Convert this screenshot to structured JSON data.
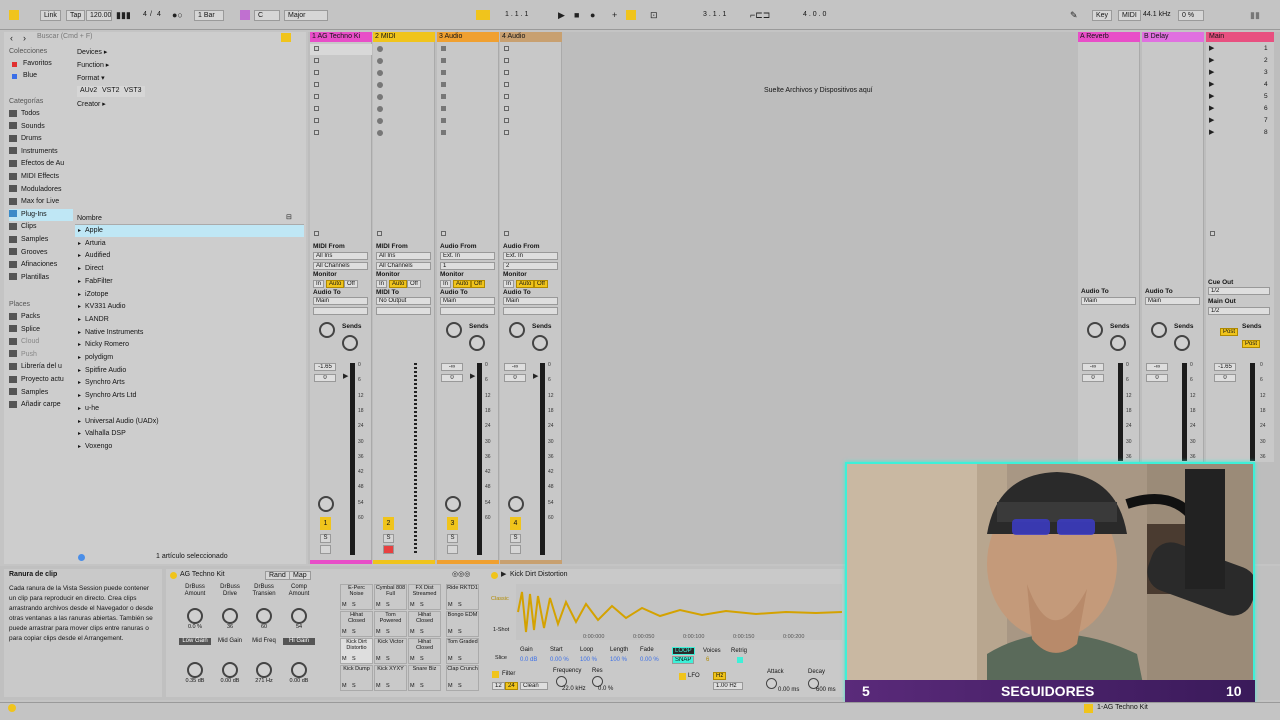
{
  "transport": {
    "link": "Link",
    "tap": "Tap",
    "bpm": "120.00",
    "time_sig_num": "4",
    "time_sig_den": "4",
    "quantize": "1 Bar",
    "key": "C",
    "scale": "Major",
    "position": "1 . 1 . 1",
    "loop_start": "3 . 1 . 1",
    "loop_length": "4 . 0 . 0",
    "key_btn": "Key",
    "midi_btn": "MIDI",
    "sample_rate": "44.1 kHz",
    "cpu": "0 %"
  },
  "browser": {
    "search_placeholder": "Buscar (Cmd + F)",
    "colecciones_header": "Colecciones",
    "colecciones": [
      "Favoritos",
      "Blue"
    ],
    "categorias_header": "Categorías",
    "categorias": [
      "Todos",
      "Sounds",
      "Drums",
      "Instruments",
      "Efectos de Au",
      "MIDI Effects",
      "Moduladores",
      "Max for Live",
      "Plug-Ins",
      "Clips",
      "Samples",
      "Grooves",
      "Afinaciones",
      "Plantillas"
    ],
    "places_header": "Places",
    "places": [
      "Packs",
      "Splice",
      "Cloud",
      "Push",
      "Librería del u",
      "Proyecto actu",
      "Samples",
      "Añadir carpe"
    ],
    "filters": {
      "devices": "Devices ▸",
      "function": "Function ▸",
      "format": "Format ▾",
      "formats": [
        "AUv2",
        "VST2",
        "VST3"
      ],
      "creator": "Creator ▸"
    },
    "nombre_header": "Nombre",
    "items": [
      "Apple",
      "Arturia",
      "Audified",
      "Direct",
      "FabFilter",
      "iZotope",
      "KV331 Audio",
      "LANDR",
      "Native Instruments",
      "Nicky Romero",
      "polydigm",
      "Spitfire Audio",
      "Synchro Arts",
      "Synchro Arts Ltd",
      "u-he",
      "Universal Audio (UADx)",
      "Valhalla DSP",
      "Voxengo"
    ],
    "status": "1 artículo seleccionado"
  },
  "session": {
    "drop_hint": "Suelte Archivos y Dispositivos aquí",
    "tracks": [
      {
        "name": "1 AG Techno Ki",
        "color": "#e84ec8",
        "num": "1",
        "from_label": "MIDI From",
        "from": "All Ins",
        "channel": "All Channels",
        "to": "Main",
        "vol": "-1.65",
        "pan": "0"
      },
      {
        "name": "2 MIDI",
        "color": "#f0c41c",
        "num": "2",
        "from_label": "MIDI From",
        "from": "All Ins",
        "channel": "All Channels",
        "to": "No Output",
        "vol": "",
        "pan": ""
      },
      {
        "name": "3 Audio",
        "color": "#f0a030",
        "num": "3",
        "from_label": "Audio From",
        "from": "Ext. In",
        "channel": "1",
        "to": "Main",
        "vol": "-∞",
        "pan": "0"
      },
      {
        "name": "4 Audio",
        "color": "#c8a070",
        "num": "4",
        "from_label": "Audio From",
        "from": "Ext. In",
        "channel": "2",
        "to": "Main",
        "vol": "-∞",
        "pan": "0"
      }
    ],
    "returns": [
      {
        "name": "A Reverb",
        "color": "#e84ec8",
        "to": "Main",
        "vol": "-∞",
        "pan": "0"
      },
      {
        "name": "B Delay",
        "color": "#e070e0",
        "to": "Main",
        "vol": "-∞",
        "pan": "0"
      }
    ],
    "main": {
      "name": "Main",
      "color": "#e85080",
      "cue_out_label": "Cue Out",
      "cue_out": "1/2",
      "main_out_label": "Main Out",
      "main_out": "1/2",
      "vol": "-1.65",
      "pan": "0",
      "post": "Post",
      "scenes": [
        "1",
        "2",
        "3",
        "4",
        "5",
        "6",
        "7",
        "8"
      ]
    },
    "labels": {
      "monitor": "Monitor",
      "in": "In",
      "auto": "Auto",
      "off": "Off",
      "audio_to": "Audio To",
      "midi_to": "MIDI To",
      "sends": "Sends",
      "audio_from": "Audio From"
    },
    "meter_ticks": [
      "0",
      "6",
      "12",
      "18",
      "24",
      "30",
      "36",
      "42",
      "48",
      "54",
      "60"
    ]
  },
  "info": {
    "title": "Ranura de clip",
    "text": "Cada ranura de la Vista Session puede contener un clip para reproducir en directo. Crea clips arrastrando archivos desde el Navegador o desde otras ventanas a las ranuras abiertas. También se puede arrastrar para mover clips entre ranuras o para copiar clips desde el Arrangement."
  },
  "rack": {
    "name": "AG Techno Kit",
    "rand": "Rand",
    "map": "Map",
    "macros": [
      {
        "label": "DrBuss Amount",
        "value": "0.0 %"
      },
      {
        "label": "DrBuss Drive",
        "value": "36"
      },
      {
        "label": "DrBuss Transien",
        "value": "60"
      },
      {
        "label": "Comp Amount",
        "value": "54"
      },
      {
        "label": "Low Gain",
        "value": "0.35 dB"
      },
      {
        "label": "Mid Gain",
        "value": "0.00 dB"
      },
      {
        "label": "Mid Freq",
        "value": "271 Hz"
      },
      {
        "label": "Hi Gain",
        "value": "0.00 dB"
      }
    ],
    "pads": [
      [
        "E-Perc Noise",
        "Cymbal 808 Full",
        "FX Dist Streamed",
        "Ride RKTD1"
      ],
      [
        "Hihat Closed",
        "Tom Powered",
        "Hihat Closed",
        "Bongo EDM"
      ],
      [
        "Kick Dirt Distortio",
        "Kick Victor",
        "Hihat Closed",
        "Tom Graded"
      ],
      [
        "Kick Dump",
        "Kick XYXY",
        "Snare Biz",
        "Clap Crunch"
      ]
    ],
    "pad_btns": [
      "M",
      "S"
    ]
  },
  "simpler": {
    "name": "Kick Dirt Distortion",
    "mode": "Classic",
    "one_shot": "1-Shot",
    "slice": "Slice",
    "params": [
      {
        "label": "Gain",
        "value": "0.0 dB"
      },
      {
        "label": "Start",
        "value": "0.00 %"
      },
      {
        "label": "Loop",
        "value": "100 %"
      },
      {
        "label": "Length",
        "value": "100 %"
      },
      {
        "label": "Fade",
        "value": "0.00 %"
      }
    ],
    "loop_btn": "LOOP",
    "snap_btn": "SNAP",
    "voices_label": "Voices",
    "voices": "6",
    "retrig_label": "Retrig",
    "timeline": [
      "0:00:000",
      "0:00:050",
      "0:00:100",
      "0:00:150",
      "0:00:200"
    ],
    "filter_label": "Filter",
    "filter_type": "12",
    "filter_type2": "24",
    "filter_mode": "Clean",
    "freq_label": "Frequency",
    "freq": "22.0 kHz",
    "res_label": "Res",
    "res": "0.0 %",
    "lfo_label": "LFO",
    "lfo_hz": "Hz",
    "lfo_rate": "1.00 Hz",
    "attack_label": "Attack",
    "attack": "0.00 ms",
    "decay_label": "Decay",
    "decay": "600 ms"
  },
  "webcam": {
    "left_num": "5",
    "label": "SEGUIDORES",
    "right_num": "10"
  },
  "statusbar": {
    "track_name": "1-AG Techno Kit"
  },
  "colors": {
    "accent": "#f0c41c",
    "select": "#bfe7f5",
    "cyan": "#3ef0d8",
    "pink": "#e84ec8"
  }
}
